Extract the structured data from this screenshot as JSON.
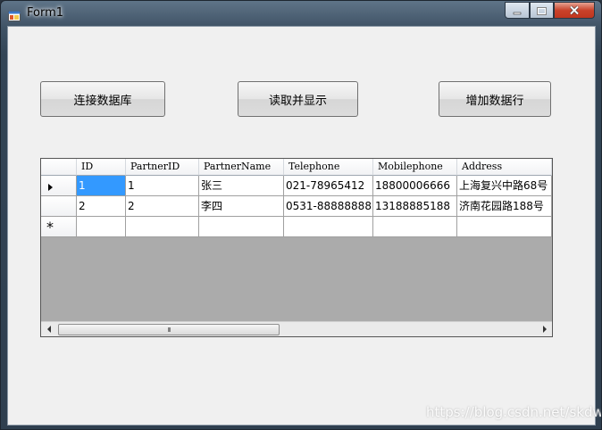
{
  "window": {
    "title": "Form1"
  },
  "buttons": {
    "connect": "连接数据库",
    "read": "读取并显示",
    "add": "增加数据行"
  },
  "grid": {
    "columns": [
      "ID",
      "PartnerID",
      "PartnerName",
      "Telephone",
      "Mobilephone",
      "Address"
    ],
    "rows": [
      [
        "1",
        "1",
        "张三",
        "021-78965412",
        "18800006666",
        "上海复兴中路68号"
      ],
      [
        "2",
        "2",
        "李四",
        "0531-88888888",
        "13188885188",
        "济南花园路188号"
      ]
    ],
    "new_row_marker": "*",
    "current_row_marker": "▶",
    "scroll_thumb_glyph": "III"
  },
  "watermark": "https://blog.csdn.net/skdwl",
  "colors": {
    "selection": "#3399ff",
    "grid_background": "#ababab",
    "form_background": "#f0f0f0"
  }
}
